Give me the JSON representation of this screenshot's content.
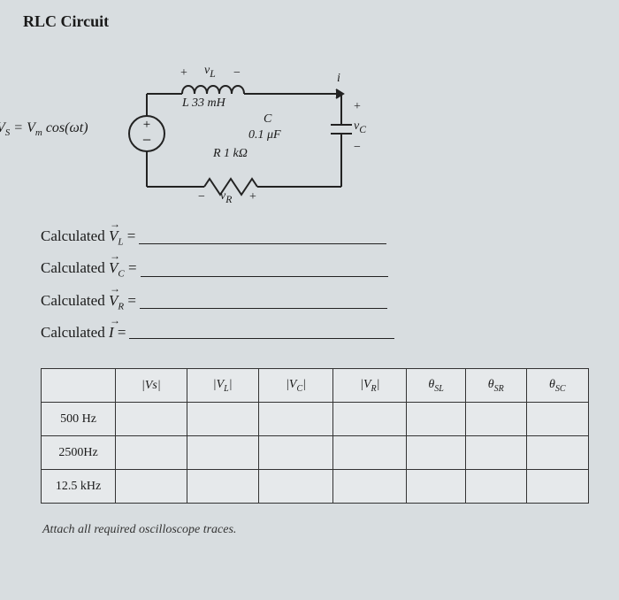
{
  "title": "RLC Circuit",
  "circuit": {
    "source": "V<sub>S</sub> = V<sub>m</sub> cos(ωt)",
    "vL": "v<sub>L</sub>",
    "L": "L  33 mH",
    "C": "C",
    "Cval": "0.1 μF",
    "R": "R 1 kΩ",
    "vR": "v<sub>R</sub>",
    "i": "i",
    "vC": "v<sub>C</sub>"
  },
  "calculated": [
    {
      "text": "Calculated ",
      "sym": "V",
      "sub": "L"
    },
    {
      "text": "Calculated ",
      "sym": "V",
      "sub": "C"
    },
    {
      "text": "Calculated ",
      "sym": "V",
      "sub": "R"
    },
    {
      "text": "Calculated ",
      "sym": "I",
      "sub": ""
    }
  ],
  "table": {
    "headers": [
      "",
      "|Vs|",
      "|V<sub>L</sub>|",
      "|V<sub>C</sub>|",
      "|V<sub>R</sub>|",
      "θ<sub>SL</sub>",
      "θ<sub>SR</sub>",
      "θ<sub>SC</sub>"
    ],
    "rows": [
      "500 Hz",
      "2500Hz",
      "12.5 kHz"
    ]
  },
  "footnote": "Attach all required oscilloscope traces."
}
